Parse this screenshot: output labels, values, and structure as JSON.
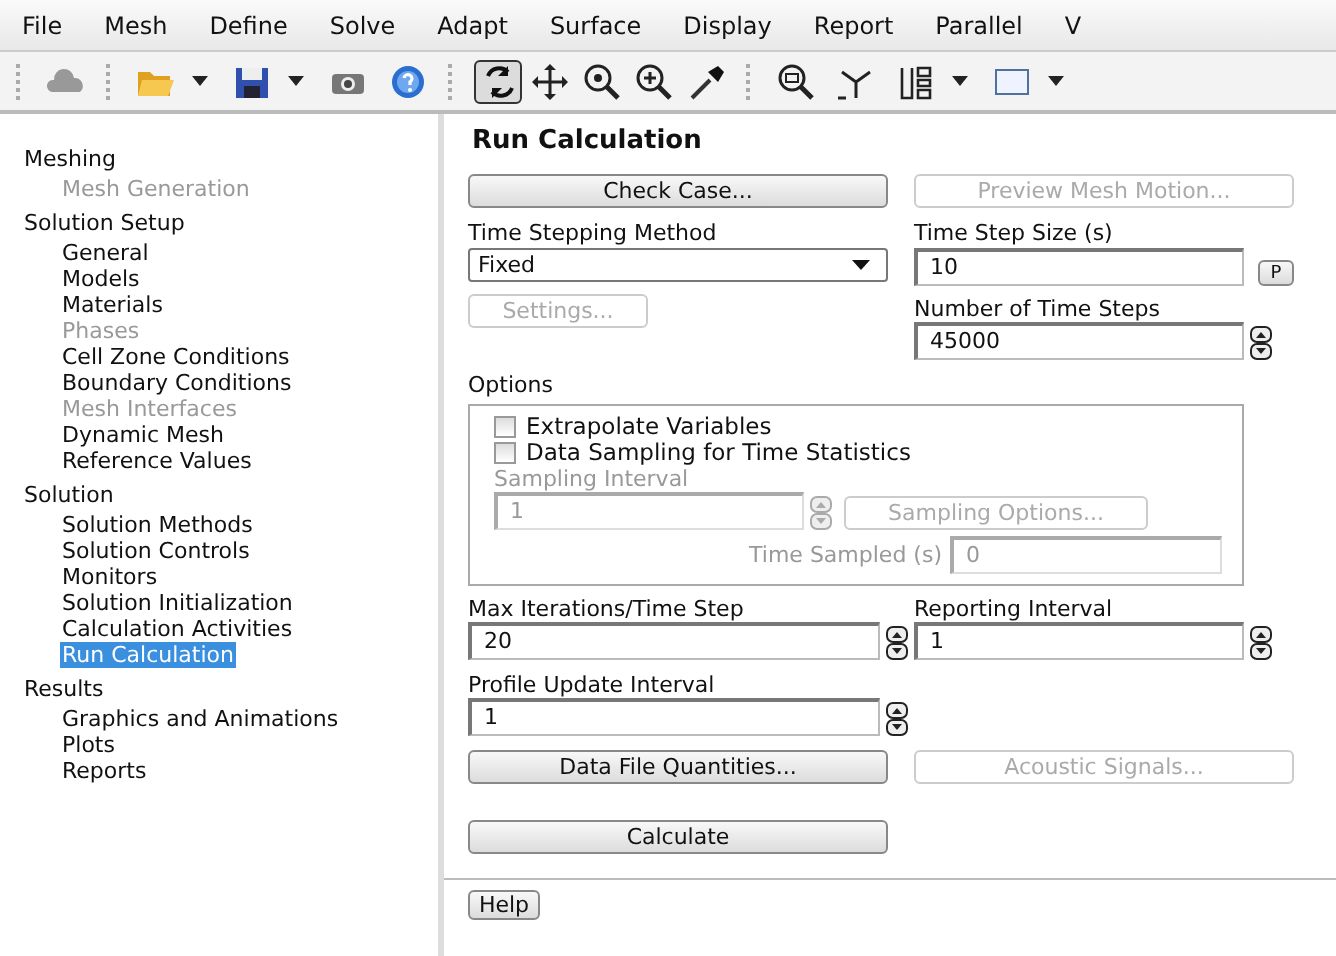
{
  "menu": [
    "File",
    "Mesh",
    "Define",
    "Solve",
    "Adapt",
    "Surface",
    "Display",
    "Report",
    "Parallel",
    "V"
  ],
  "mouse_modes": [
    {
      "selected": true
    },
    {
      "selected": false
    },
    {
      "selected": false
    },
    {
      "selected": false
    },
    {
      "selected": false
    }
  ],
  "tree": [
    {
      "label": "Meshing",
      "children": [
        {
          "label": "Mesh Generation",
          "disabled": true,
          "selected": false
        }
      ]
    },
    {
      "label": "Solution Setup",
      "children": [
        {
          "label": "General",
          "disabled": false,
          "selected": false
        },
        {
          "label": "Models",
          "disabled": false,
          "selected": false
        },
        {
          "label": "Materials",
          "disabled": false,
          "selected": false
        },
        {
          "label": "Phases",
          "disabled": true,
          "selected": false
        },
        {
          "label": "Cell Zone Conditions",
          "disabled": false,
          "selected": false
        },
        {
          "label": "Boundary Conditions",
          "disabled": false,
          "selected": false
        },
        {
          "label": "Mesh Interfaces",
          "disabled": true,
          "selected": false
        },
        {
          "label": "Dynamic Mesh",
          "disabled": false,
          "selected": false
        },
        {
          "label": "Reference Values",
          "disabled": false,
          "selected": false
        }
      ]
    },
    {
      "label": "Solution",
      "children": [
        {
          "label": "Solution Methods",
          "disabled": false,
          "selected": false
        },
        {
          "label": "Solution Controls",
          "disabled": false,
          "selected": false
        },
        {
          "label": "Monitors",
          "disabled": false,
          "selected": false
        },
        {
          "label": "Solution Initialization",
          "disabled": false,
          "selected": false
        },
        {
          "label": "Calculation Activities",
          "disabled": false,
          "selected": false
        },
        {
          "label": "Run Calculation",
          "disabled": false,
          "selected": true
        }
      ]
    },
    {
      "label": "Results",
      "children": [
        {
          "label": "Graphics and Animations",
          "disabled": false,
          "selected": false
        },
        {
          "label": "Plots",
          "disabled": false,
          "selected": false
        },
        {
          "label": "Reports",
          "disabled": false,
          "selected": false
        }
      ]
    }
  ],
  "panel": {
    "title": "Run Calculation",
    "check_case": {
      "label": "Check Case...",
      "disabled": false
    },
    "preview_mesh_motion": {
      "label": "Preview Mesh Motion...",
      "disabled": true
    },
    "time_stepping_method": {
      "label": "Time Stepping Method",
      "value": "Fixed"
    },
    "settings": {
      "label": "Settings...",
      "disabled": true
    },
    "time_step_size": {
      "label": "Time Step Size (s)",
      "value": "10",
      "param_button": "P"
    },
    "number_of_time_steps": {
      "label": "Number of Time Steps",
      "value": "45000"
    },
    "options": {
      "label": "Options",
      "checkboxes": [
        {
          "label": "Extrapolate Variables",
          "checked": false
        },
        {
          "label": "Data Sampling for Time Statistics",
          "checked": false
        }
      ],
      "sampling_interval": {
        "label": "Sampling Interval",
        "value": "1",
        "disabled": true
      },
      "sampling_options": {
        "label": "Sampling Options...",
        "disabled": true
      },
      "time_sampled": {
        "label": "Time Sampled (s)",
        "value": "0",
        "disabled": true
      }
    },
    "max_iterations": {
      "label": "Max Iterations/Time Step",
      "value": "20"
    },
    "reporting_interval": {
      "label": "Reporting Interval",
      "value": "1"
    },
    "profile_update_interval": {
      "label": "Profile Update Interval",
      "value": "1"
    },
    "data_file_quantities": {
      "label": "Data File Quantities...",
      "disabled": false
    },
    "acoustic_signals": {
      "label": "Acoustic Signals...",
      "disabled": true
    },
    "calculate": {
      "label": "Calculate",
      "disabled": false
    },
    "help": {
      "label": "Help",
      "disabled": false
    }
  }
}
